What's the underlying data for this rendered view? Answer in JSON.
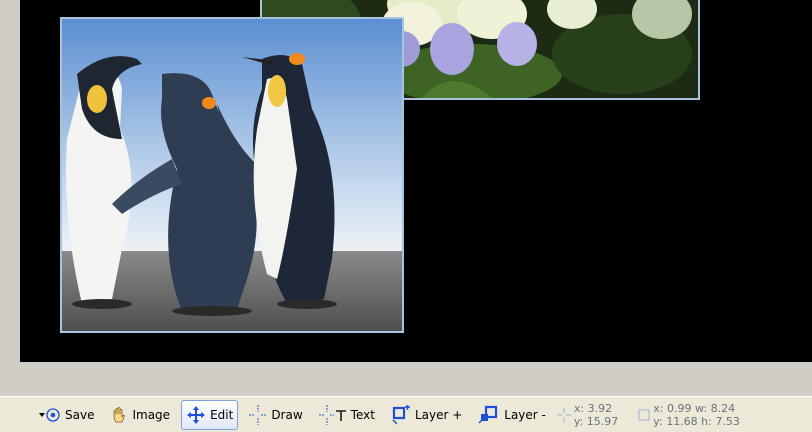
{
  "toolbar": {
    "save_label": "Save",
    "image_label": "Image",
    "edit_label": "Edit",
    "draw_label": "Draw",
    "text_label": "Text",
    "layer_add_label": "Layer +",
    "layer_remove_label": "Layer -",
    "cursor_x": "x: 3.92",
    "cursor_y": "y: 15.97",
    "sel_line1": "x: 0.99 w: 8.24",
    "sel_line2": "y: 11.68 h: 7.53"
  },
  "colors": {
    "stage_background": "#000000",
    "photo_border": "#a7c3de",
    "active_button_border": "#7fa3d6",
    "icon_blue": "#1f4fd8",
    "toolbar_background": "#ece9d8"
  },
  "icons": {
    "save": "save-dropdown-icon",
    "image": "hand-icon",
    "edit": "move-arrows-icon",
    "draw": "crosshair-icon",
    "text": "crosshair-text-icon",
    "layer_add": "layer-add-icon",
    "layer_remove": "layer-remove-icon",
    "cursor": "cursor-position-icon",
    "selection": "selection-rect-icon"
  }
}
